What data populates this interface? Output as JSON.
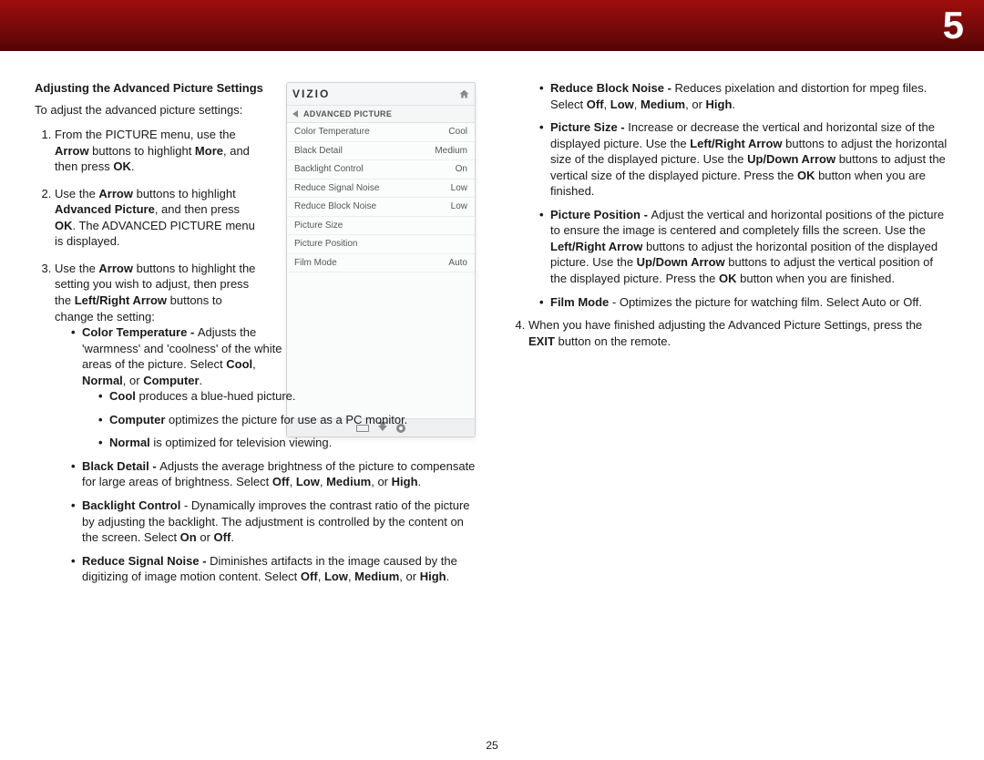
{
  "page_number": "25",
  "chapter_number": "5",
  "heading": "Adjusting the Advanced Picture Settings",
  "intro": "To adjust the advanced picture settings:",
  "menu": {
    "logo": "VIZIO",
    "crumb": "ADVANCED PICTURE",
    "rows": [
      {
        "label": "Color Temperature",
        "value": "Cool"
      },
      {
        "label": "Black Detail",
        "value": "Medium"
      },
      {
        "label": "Backlight Control",
        "value": "On"
      },
      {
        "label": "Reduce Signal Noise",
        "value": "Low"
      },
      {
        "label": "Reduce Block Noise",
        "value": "Low"
      },
      {
        "label": "Picture Size",
        "value": ""
      },
      {
        "label": "Picture Position",
        "value": ""
      },
      {
        "label": "Film Mode",
        "value": "Auto"
      }
    ]
  },
  "left": {
    "step1": {
      "a": "From the PICTURE menu, use the ",
      "b": "Arrow",
      "c": " buttons to highlight ",
      "d": "More",
      "e": ", and then press ",
      "f": "OK",
      "g": "."
    },
    "step2": {
      "a": "Use the ",
      "b": "Arrow",
      "c": " buttons to highlight ",
      "d": "Advanced Picture",
      "e": ", and then press ",
      "f": "OK",
      "g": ". The ADVANCED PICTURE menu is displayed."
    },
    "step3": {
      "a": "Use the ",
      "b": "Arrow",
      "c": " buttons to highlight the setting you wish to adjust, then press the ",
      "d": "Left/Right Arrow",
      "e": " buttons to change the setting:"
    },
    "ct": {
      "t": "Color Temperature - ",
      "a": "Adjusts the 'warmness' and 'coolness' of the white areas of the picture. Select ",
      "b": "Cool",
      "c": ", ",
      "d": "Normal",
      "e": ", or ",
      "f": "Computer",
      "g": "."
    },
    "ct_cool": {
      "t": "Cool",
      "a": " produces a blue-hued picture."
    },
    "ct_comp": {
      "t": "Computer",
      "a": " optimizes the picture for use as a PC monitor."
    },
    "ct_norm": {
      "t": "Normal",
      "a": " is optimized for television viewing."
    },
    "bd": {
      "t": "Black Detail - ",
      "a": "Adjusts the average brightness of the picture to compensate for large areas of brightness. Select ",
      "b": "Off",
      "c": ", ",
      "d": "Low",
      "e": ", ",
      "f": "Medium",
      "g": ", or ",
      "h": "High",
      "i": "."
    },
    "bl": {
      "t": "Backlight Control",
      "a": " - Dynamically improves the contrast ratio of the picture by adjusting the backlight. The adjustment is controlled by the content on the screen. Select ",
      "b": "On",
      "c": " or ",
      "d": "Off",
      "e": "."
    },
    "rsn": {
      "t": "Reduce Signal Noise - ",
      "a": "Diminishes artifacts in the image caused by the digitizing of image motion content. Select ",
      "b": "Off",
      "c": ", ",
      "d": "Low",
      "e": ", ",
      "f": "Medium",
      "g": ", or ",
      "h": "High",
      "i": "."
    }
  },
  "right": {
    "rbn": {
      "t": "Reduce Block Noise - ",
      "a": "Reduces pixelation and distortion for mpeg files. Select ",
      "b": "Off",
      "c": ", ",
      "d": "Low",
      "e": ", ",
      "f": "Medium",
      "g": ", or ",
      "h": "High",
      "i": "."
    },
    "psize": {
      "t": "Picture Size - ",
      "a": "Increase or decrease the vertical and horizontal size of the displayed picture. Use the ",
      "b": "Left/Right Arrow",
      "c": " buttons to adjust the horizontal size of the displayed picture. Use the ",
      "d": "Up/Down Arrow",
      "e": " buttons to adjust the vertical size of the displayed picture. Press the ",
      "f": "OK",
      "g": " button when you are finished."
    },
    "ppos": {
      "t": "Picture Position - ",
      "a": "Adjust the vertical and horizontal positions of the picture to ensure the image is centered and completely fills the screen. Use the ",
      "b": "Left/Right Arrow",
      "c": " buttons to adjust the horizontal position of the displayed picture. Use the ",
      "d": "Up/Down Arrow",
      "e": " buttons to adjust the vertical position of the displayed picture. Press the ",
      "f": "OK",
      "g": " button when you are finished."
    },
    "film": {
      "t": "Film Mode",
      "a": " - Optimizes the picture for watching film. Select Auto or Off."
    },
    "step4": {
      "a": "When you have finished adjusting the Advanced Picture Settings, press the ",
      "b": "EXIT",
      "c": " button on the remote."
    }
  }
}
